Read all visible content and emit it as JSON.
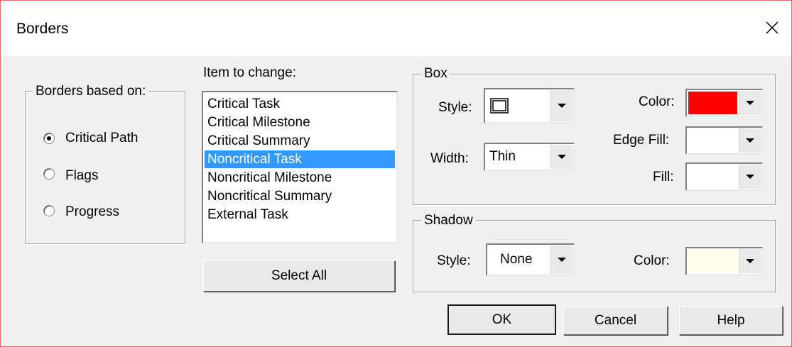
{
  "dialog": {
    "title": "Borders"
  },
  "borders_based_on": {
    "legend": "Borders based on:",
    "options": [
      "Critical Path",
      "Flags",
      "Progress"
    ],
    "selected": "Critical Path"
  },
  "items": {
    "label": "Item to change:",
    "list": [
      "Critical Task",
      "Critical Milestone",
      "Critical Summary",
      "Noncritical Task",
      "Noncritical Milestone",
      "Noncritical Summary",
      "External Task"
    ],
    "selected": "Noncritical Task",
    "select_all": "Select All"
  },
  "box": {
    "legend": "Box",
    "style_label": "Style:",
    "style_value": "rectangle-outline",
    "width_label": "Width:",
    "width_value": "Thin",
    "color_label": "Color:",
    "color_value": "#ff0000",
    "edge_fill_label": "Edge Fill:",
    "edge_fill_value": "#ffffff",
    "fill_label": "Fill:",
    "fill_value": "#ffffff"
  },
  "shadow": {
    "legend": "Shadow",
    "style_label": "Style:",
    "style_value": "None",
    "color_label": "Color:",
    "color_value": "#fffde8"
  },
  "buttons": {
    "ok": "OK",
    "cancel": "Cancel",
    "help": "Help"
  },
  "icons": {
    "close": "close-icon",
    "dropdown": "chevron-down-icon",
    "radio": "radio-icon"
  }
}
